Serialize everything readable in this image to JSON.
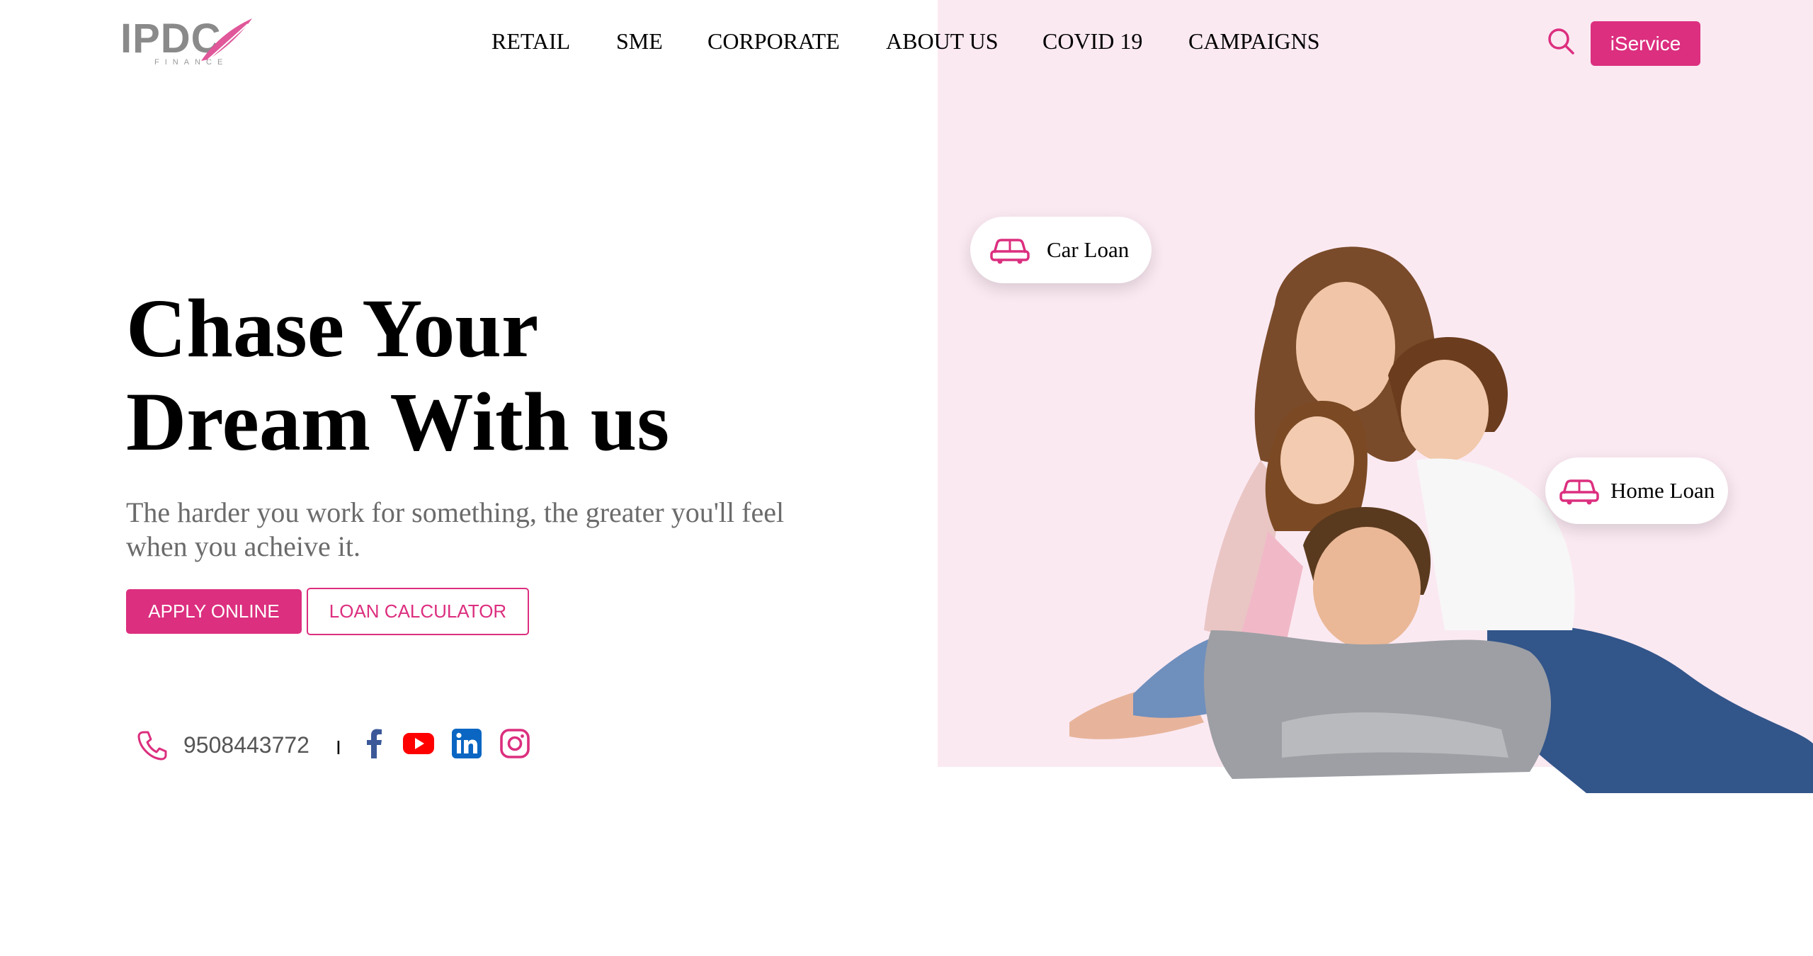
{
  "brand": {
    "logo_text": "IPDC",
    "logo_subtext": "FINANCE",
    "accent_color": "#dc2f7f",
    "panel_color": "#fbe9f2"
  },
  "nav": {
    "items": [
      {
        "label": "RETAIL"
      },
      {
        "label": "SME"
      },
      {
        "label": "CORPORATE"
      },
      {
        "label": "ABOUT US"
      },
      {
        "label": "COVID 19"
      },
      {
        "label": "CAMPAIGNS"
      }
    ],
    "search_icon": "search-icon",
    "iservice_label": "iService"
  },
  "hero": {
    "title_line1": "Chase Your",
    "title_line2": "Dream With us",
    "subtitle": "The harder you work for something, the greater you'll feel when you acheive it.",
    "apply_label": "APPLY ONLINE",
    "calculator_label": "LOAN CALCULATOR"
  },
  "contact": {
    "phone_icon": "phone-icon",
    "phone": "9508443772",
    "divider": "I",
    "social": [
      {
        "name": "facebook-icon",
        "color": "#3b5998"
      },
      {
        "name": "youtube-icon",
        "color": "#ff0000"
      },
      {
        "name": "linkedin-icon",
        "color": "#0a66c2"
      },
      {
        "name": "instagram-icon",
        "color": "#dc2f7f"
      }
    ]
  },
  "pills": [
    {
      "label": "Car Loan",
      "icon": "car-icon"
    },
    {
      "label": "Home Loan",
      "icon": "car-icon"
    }
  ]
}
